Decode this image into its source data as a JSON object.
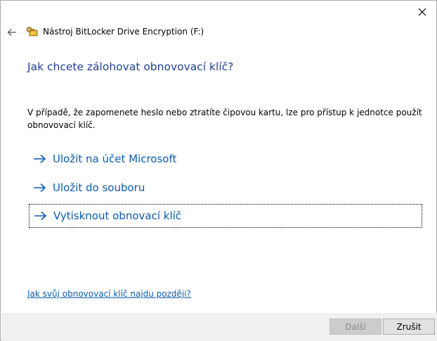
{
  "window": {
    "title": "Nástroj BitLocker Drive Encryption (F:)",
    "close_label": "Close"
  },
  "main": {
    "heading": "Jak chcete zálohovat obnovovací klíč?",
    "description": "V případě, že zapomenete heslo nebo ztratíte čipovou kartu, lze pro přístup k jednotce použít obnovovací klíč.",
    "options": [
      {
        "label": "Uložit na účet Microsoft"
      },
      {
        "label": "Uložit do souboru"
      },
      {
        "label": "Vytisknout obnovací klíč",
        "focused": true
      }
    ],
    "help_link": "Jak svůj obnovovací klíč najdu později?"
  },
  "footer": {
    "next_label": "Další",
    "cancel_label": "Zrušit",
    "next_enabled": false
  },
  "colors": {
    "heading": "#1f3f94",
    "link": "#0b5cad",
    "footer_bg": "#f0f0f0"
  },
  "icons": {
    "close": "close-icon",
    "back": "back-arrow-icon",
    "app": "bitlocker-key-icon",
    "option_arrow": "arrow-right-icon"
  }
}
